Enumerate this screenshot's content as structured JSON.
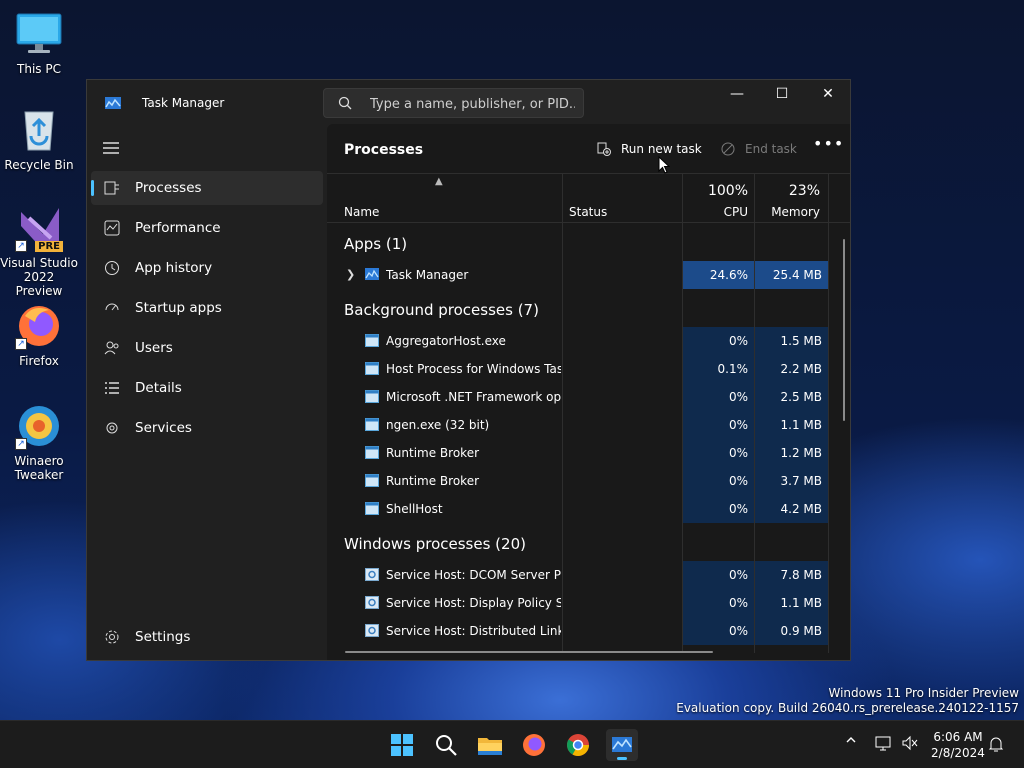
{
  "desktop": {
    "icons": [
      {
        "label": "This PC"
      },
      {
        "label": "Recycle Bin"
      },
      {
        "label": "Visual Studio 2022 Preview",
        "badge": "PRE"
      },
      {
        "label": "Firefox"
      },
      {
        "label": "Winaero Tweaker"
      }
    ]
  },
  "window": {
    "title": "Task Manager",
    "search_placeholder": "Type a name, publisher, or PID...",
    "controls": {
      "minimize": "—",
      "maximize": "☐",
      "close": "✕"
    }
  },
  "nav": {
    "items": [
      {
        "label": "Processes",
        "icon": "processes-icon",
        "active": true
      },
      {
        "label": "Performance",
        "icon": "performance-icon"
      },
      {
        "label": "App history",
        "icon": "app-history-icon"
      },
      {
        "label": "Startup apps",
        "icon": "startup-apps-icon"
      },
      {
        "label": "Users",
        "icon": "users-icon"
      },
      {
        "label": "Details",
        "icon": "details-icon"
      },
      {
        "label": "Services",
        "icon": "services-icon"
      }
    ],
    "settings": "Settings"
  },
  "main": {
    "title": "Processes",
    "run_new_task": "Run new task",
    "end_task": "End task",
    "more": "•••"
  },
  "columns": {
    "name": "Name",
    "status": "Status",
    "cpu_pct": "100%",
    "cpu": "CPU",
    "mem_pct": "23%",
    "memory": "Memory"
  },
  "groups": {
    "apps": "Apps (1)",
    "background": "Background processes (7)",
    "windows": "Windows processes (20)"
  },
  "apps": [
    {
      "name": "Task Manager",
      "cpu": "24.6%",
      "mem": "25.4 MB"
    }
  ],
  "background": [
    {
      "name": "AggregatorHost.exe",
      "cpu": "0%",
      "mem": "1.5 MB"
    },
    {
      "name": "Host Process for Windows Tasks",
      "cpu": "0.1%",
      "mem": "2.2 MB"
    },
    {
      "name": "Microsoft .NET Framework op...",
      "cpu": "0%",
      "mem": "2.5 MB"
    },
    {
      "name": "ngen.exe (32 bit)",
      "cpu": "0%",
      "mem": "1.1 MB"
    },
    {
      "name": "Runtime Broker",
      "cpu": "0%",
      "mem": "1.2 MB"
    },
    {
      "name": "Runtime Broker",
      "cpu": "0%",
      "mem": "3.7 MB"
    },
    {
      "name": "ShellHost",
      "cpu": "0%",
      "mem": "4.2 MB"
    }
  ],
  "windows": [
    {
      "name": "Service Host: DCOM Server Pr...",
      "cpu": "0%",
      "mem": "7.8 MB"
    },
    {
      "name": "Service Host: Display Policy Se...",
      "cpu": "0%",
      "mem": "1.1 MB"
    },
    {
      "name": "Service Host: Distributed Link ...",
      "cpu": "0%",
      "mem": "0.9 MB"
    }
  ],
  "watermark": {
    "line1": "Windows 11 Pro Insider Preview",
    "line2": "Evaluation copy. Build 26040.rs_prerelease.240122-1157"
  },
  "taskbar": {
    "apps": [
      "start-icon",
      "search-icon",
      "file-explorer-icon",
      "firefox-icon",
      "chrome-icon",
      "task-manager-icon"
    ],
    "time": "6:06 AM",
    "date": "2/8/2024"
  },
  "colors": {
    "accent": "#4cc2ff",
    "highlight": "#1c4b8a",
    "heat": "#0f2a4d"
  }
}
